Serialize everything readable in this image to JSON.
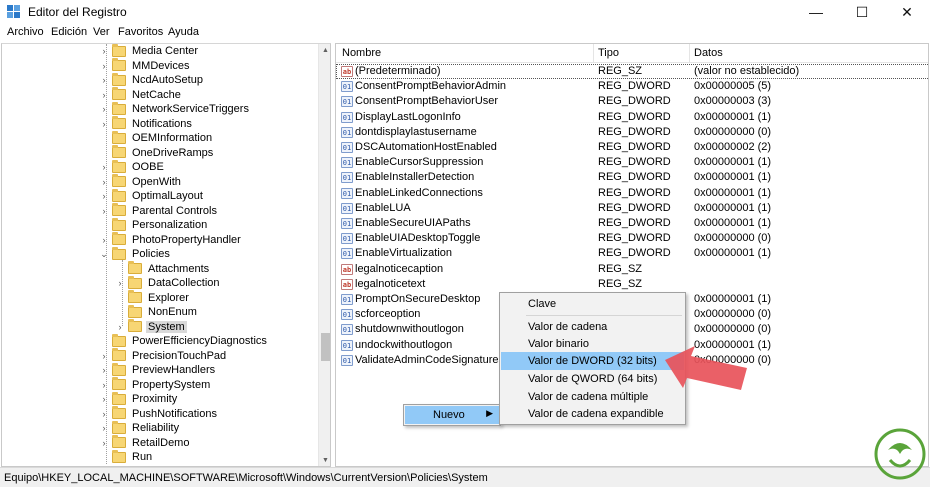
{
  "window": {
    "title": "Editor del Registro",
    "controls": {
      "minimize": "—",
      "maximize": "☐",
      "close": "✕"
    }
  },
  "menu": [
    "Archivo",
    "Edición",
    "Ver",
    "Favoritos",
    "Ayuda"
  ],
  "tree": {
    "items": [
      "Media Center",
      "MMDevices",
      "NcdAutoSetup",
      "NetCache",
      "NetworkServiceTriggers",
      "Notifications",
      "OEMInformation",
      "OneDriveRamps",
      "OOBE",
      "OpenWith",
      "OptimalLayout",
      "Parental Controls",
      "Personalization",
      "PhotoPropertyHandler",
      "Policies",
      "Attachments",
      "DataCollection",
      "Explorer",
      "NonEnum",
      "System",
      "PowerEfficiencyDiagnostics",
      "PrecisionTouchPad",
      "PreviewHandlers",
      "PropertySystem",
      "Proximity",
      "PushNotifications",
      "Reliability",
      "RetailDemo",
      "Run"
    ]
  },
  "list": {
    "headers": {
      "name": "Nombre",
      "type": "Tipo",
      "data": "Datos"
    },
    "rows": [
      {
        "name": "(Predeterminado)",
        "type": "REG_SZ",
        "data": "(valor no establecido)",
        "icon": "string"
      },
      {
        "name": "ConsentPromptBehaviorAdmin",
        "type": "REG_DWORD",
        "data": "0x00000005 (5)",
        "icon": "binary"
      },
      {
        "name": "ConsentPromptBehaviorUser",
        "type": "REG_DWORD",
        "data": "0x00000003 (3)",
        "icon": "binary"
      },
      {
        "name": "DisplayLastLogonInfo",
        "type": "REG_DWORD",
        "data": "0x00000001 (1)",
        "icon": "binary"
      },
      {
        "name": "dontdisplaylastusername",
        "type": "REG_DWORD",
        "data": "0x00000000 (0)",
        "icon": "binary"
      },
      {
        "name": "DSCAutomationHostEnabled",
        "type": "REG_DWORD",
        "data": "0x00000002 (2)",
        "icon": "binary"
      },
      {
        "name": "EnableCursorSuppression",
        "type": "REG_DWORD",
        "data": "0x00000001 (1)",
        "icon": "binary"
      },
      {
        "name": "EnableInstallerDetection",
        "type": "REG_DWORD",
        "data": "0x00000001 (1)",
        "icon": "binary"
      },
      {
        "name": "EnableLinkedConnections",
        "type": "REG_DWORD",
        "data": "0x00000001 (1)",
        "icon": "binary"
      },
      {
        "name": "EnableLUA",
        "type": "REG_DWORD",
        "data": "0x00000001 (1)",
        "icon": "binary"
      },
      {
        "name": "EnableSecureUIAPaths",
        "type": "REG_DWORD",
        "data": "0x00000001 (1)",
        "icon": "binary"
      },
      {
        "name": "EnableUIADesktopToggle",
        "type": "REG_DWORD",
        "data": "0x00000000 (0)",
        "icon": "binary"
      },
      {
        "name": "EnableVirtualization",
        "type": "REG_DWORD",
        "data": "0x00000001 (1)",
        "icon": "binary"
      },
      {
        "name": "legalnoticecaption",
        "type": "REG_SZ",
        "data": "",
        "icon": "string"
      },
      {
        "name": "legalnoticetext",
        "type": "REG_SZ",
        "data": "",
        "icon": "string"
      },
      {
        "name": "PromptOnSecureDesktop",
        "type": "",
        "data": "0x00000001 (1)",
        "icon": "binary"
      },
      {
        "name": "scforceoption",
        "type": "",
        "data": "0x00000000 (0)",
        "icon": "binary"
      },
      {
        "name": "shutdownwithoutlogon",
        "type": "",
        "data": "0x00000000 (0)",
        "icon": "binary"
      },
      {
        "name": "undockwithoutlogon",
        "type": "",
        "data": "0x00000001 (1)",
        "icon": "binary"
      },
      {
        "name": "ValidateAdminCodeSignatures",
        "type": "",
        "data": "0x00000000 (0)",
        "icon": "binary"
      }
    ]
  },
  "context_menu": {
    "main_item": "Nuevo",
    "sub_items": [
      "Clave",
      "Valor de cadena",
      "Valor binario",
      "Valor de DWORD (32 bits)",
      "Valor de QWORD (64 bits)",
      "Valor de cadena múltiple",
      "Valor de cadena expandible"
    ],
    "highlighted": "Valor de DWORD (32 bits)"
  },
  "status": {
    "path": "Equipo\\HKEY_LOCAL_MACHINE\\SOFTWARE\\Microsoft\\Windows\\CurrentVersion\\Policies\\System"
  },
  "colors": {
    "accent": "#91c9f7",
    "folder": "#f7d674",
    "arrow": "#e8525a",
    "watermark": "#5aa43a"
  }
}
